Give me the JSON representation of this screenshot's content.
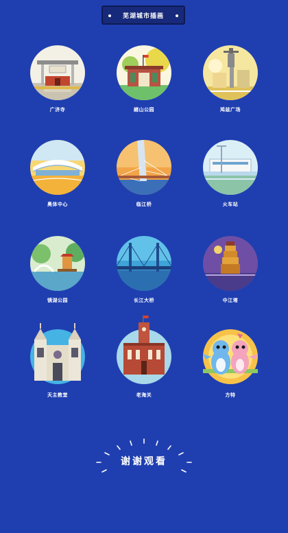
{
  "header": {
    "title": "芜湖城市插画"
  },
  "items": [
    {
      "label": "广济寺",
      "icon": "temple-gate"
    },
    {
      "label": "赭山公园",
      "icon": "park-gate"
    },
    {
      "label": "鸠兹广场",
      "icon": "statue-plaza"
    },
    {
      "label": "奥体中心",
      "icon": "stadium"
    },
    {
      "label": "临江桥",
      "icon": "cable-bridge-tower"
    },
    {
      "label": "火车站",
      "icon": "train-station"
    },
    {
      "label": "镜湖公园",
      "icon": "lake-pavilion"
    },
    {
      "label": "长江大桥",
      "icon": "river-bridge"
    },
    {
      "label": "中江塔",
      "icon": "pagoda"
    },
    {
      "label": "天主教堂",
      "icon": "cathedral"
    },
    {
      "label": "老海关",
      "icon": "customs-house"
    },
    {
      "label": "方特",
      "icon": "dinosaur-mascots"
    }
  ],
  "footer": {
    "thanks": "谢谢观看"
  }
}
